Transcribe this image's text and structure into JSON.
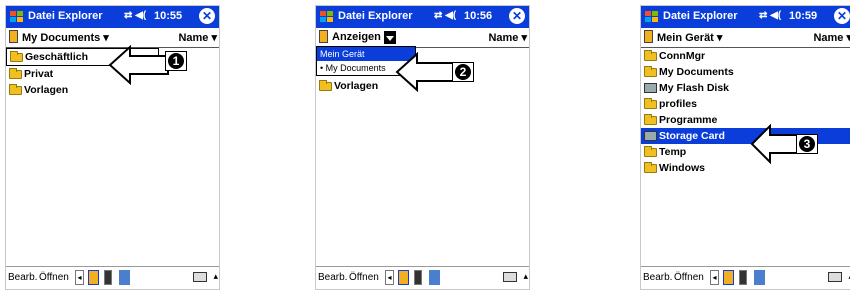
{
  "screens": [
    {
      "title": "Datei Explorer",
      "time": "10:55",
      "folder": "My Documents",
      "sort": "Name",
      "items": [
        "Geschäftlich",
        "Privat",
        "Vorlagen"
      ],
      "selected_index": 0,
      "step": "1"
    },
    {
      "title": "Datei Explorer",
      "time": "10:56",
      "folder": "Anzeigen",
      "sort": "Name",
      "dropdown": [
        "Mein Gerät",
        "• My Documents"
      ],
      "items": [
        "Vorlagen"
      ],
      "step": "2"
    },
    {
      "title": "Datei Explorer",
      "time": "10:59",
      "folder": "Mein Gerät",
      "sort": "Name",
      "items": [
        "ConnMgr",
        "My Documents",
        "My Flash Disk",
        "profiles",
        "Programme",
        "Storage Card",
        "Temp",
        "Windows"
      ],
      "selected_index": 5,
      "step": "3"
    }
  ],
  "toolbar": {
    "edit": "Bearb.",
    "open": "Öffnen"
  },
  "icons": {
    "close": "close-icon",
    "start": "windows-flag-icon",
    "connectivity": "connectivity-icon",
    "volume": "speaker-icon"
  },
  "colors": {
    "titlebar": "#0a3dd9",
    "selection": "#0a3dd9"
  }
}
